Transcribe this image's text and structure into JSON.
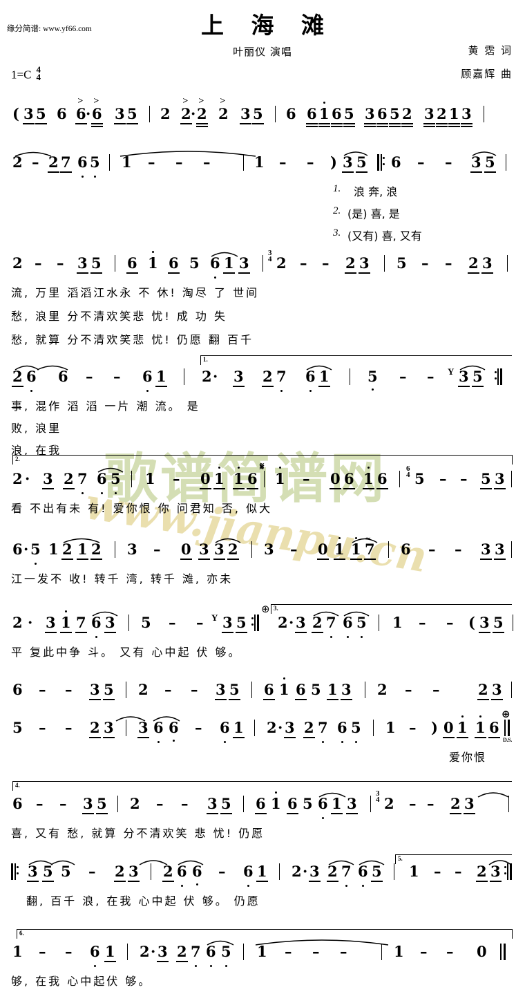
{
  "header": {
    "site_credit": "缘分简谱: www.yf66.com",
    "title": "上 海 滩",
    "performer": "叶丽仪 演唱",
    "lyricist": "黄  霑 词",
    "composer": "顾嘉辉 曲",
    "key": "1=C",
    "time_top": "4",
    "time_bottom": "4"
  },
  "watermark": {
    "cjk": "歌谱简谱网",
    "url": "www.jianpu.cn",
    "color_cjk": "#cdd9a8",
    "color_url": "#e8dca6"
  },
  "notation": {
    "time_change_34": "3/4",
    "time_change_64": "6/4",
    "segno": "𝄋",
    "coda": "⊕",
    "ds_label": "D.S.",
    "breath_mark": "Y",
    "ending_labels": [
      "1.",
      "2.",
      "3.",
      "4.",
      "5.",
      "6."
    ],
    "verse_numbers": [
      "1.",
      "2.",
      "3."
    ]
  },
  "systems": [
    {
      "id": "system-1",
      "notes": "( 3 5  6  6·6  3 5 | 2  2·2  2  3 5 | 6  6 1 6 5  3 6 5 2  3 2 1 3 |",
      "lyrics": []
    },
    {
      "id": "system-2",
      "notes": "2 — 2 7 6 5 | 1 — — — | 1 — — ) 3 5 ‖: 6 — — 3 5 |",
      "lyrics": [
        {
          "verse": "1.",
          "text": "浪    奔,      浪"
        },
        {
          "verse": "2.",
          "text": "(是)   喜,      是"
        },
        {
          "verse": "3.",
          "text": "(又有) 喜,      又有"
        }
      ]
    },
    {
      "id": "system-3",
      "notes": "2 — — 3 5 | 6 1 6 5 6 1 3 | 2 — — 2 3 | 5 — — 2 3 |",
      "lyrics": [
        {
          "verse": "1",
          "text": "流,   万里 滔滔江水永 不 休!  淘尽 了   世间"
        },
        {
          "verse": "2",
          "text": "愁,   浪里 分不清欢笑悲 忧!  成  功   失"
        },
        {
          "verse": "3",
          "text": "愁,   就算 分不清欢笑悲 忧!  仍愿 翻   百千"
        }
      ]
    },
    {
      "id": "system-4",
      "notes": "2 6  6 — — 6 1 | 2· 3  2 7  6 1 | 5 — — Y 3 5 :‖",
      "ending": "1.",
      "lyrics": [
        {
          "verse": "1",
          "text": "事,     混作 滔 滔 一片 潮  流。   是"
        },
        {
          "verse": "2",
          "text": "败,     浪里"
        },
        {
          "verse": "3",
          "text": "浪,     在我"
        }
      ]
    },
    {
      "id": "system-5",
      "notes": "2· 3 2 7 6 5 | 1 — 0 1 1 6 | 1 — 0 6 1 6 | 5 — — 5 3 |",
      "ending": "2.",
      "lyrics": [
        {
          "verse": "",
          "text": "看 不出有未  有!     爱你恨 你     问君知  否,    似大"
        }
      ]
    },
    {
      "id": "system-6",
      "notes": "6·5 1 2 1 2 | 3 — 0 3 3 2 | 3 — 0 1 1 7 | 6 — — 3 3 |",
      "lyrics": [
        {
          "verse": "",
          "text": "江一发不   收!   转千 湾,   转千 滩,    亦未"
        }
      ]
    },
    {
      "id": "system-7",
      "notes": "2· 3 1 7 6 3 | 5 — — Y 3 5 :‖ 2·3 2 7 6 5 | 1 — — ( 3 5 |",
      "ending": "3.",
      "lyrics": [
        {
          "verse": "",
          "text": "平 复此中争  斗。   又有 心中起 伏  够。"
        }
      ]
    },
    {
      "id": "system-8",
      "notes": "6 — — 3 5 | 2 — — 3 5 | 6 1 6 5 1 3 | 2 — — 2 3 |",
      "lyrics": []
    },
    {
      "id": "system-9",
      "notes": "5 — — 2 3 | 3 6 6 — 6 1 | 2·3 2 7 6 5 | 1 — ) 0 1 1 6 ‖",
      "lyrics": [
        {
          "verse": "",
          "text": "爱你恨"
        }
      ]
    },
    {
      "id": "system-10",
      "notes": "6 — — 3 5 | 2 — — 3 5 | 6 1 6 5 6 1 3 | 2 — — 2 3 |",
      "ending": "4.",
      "lyrics": [
        {
          "verse": "",
          "text": "喜,   又有 愁,   就算 分不清欢笑 悲 忧!  仍愿"
        }
      ]
    },
    {
      "id": "system-11",
      "notes": "‖: 3 5 5 — 2 3 | 2 6 6 — 6 1 | 2·3 2 7 6 5 | 1 — — 2 3 :‖",
      "ending": "5.",
      "lyrics": [
        {
          "verse": "",
          "text": "翻,   百千 浪,   在我 心中起 伏  够。  仍愿"
        }
      ]
    },
    {
      "id": "system-12",
      "notes": "1 — — 6 1 | 2·3 2 7 6 5 | 1 — — — | 1 — — 0 ‖",
      "ending": "6.",
      "lyrics": [
        {
          "verse": "",
          "text": "够,  在我 心中起伏   够。"
        }
      ]
    }
  ]
}
